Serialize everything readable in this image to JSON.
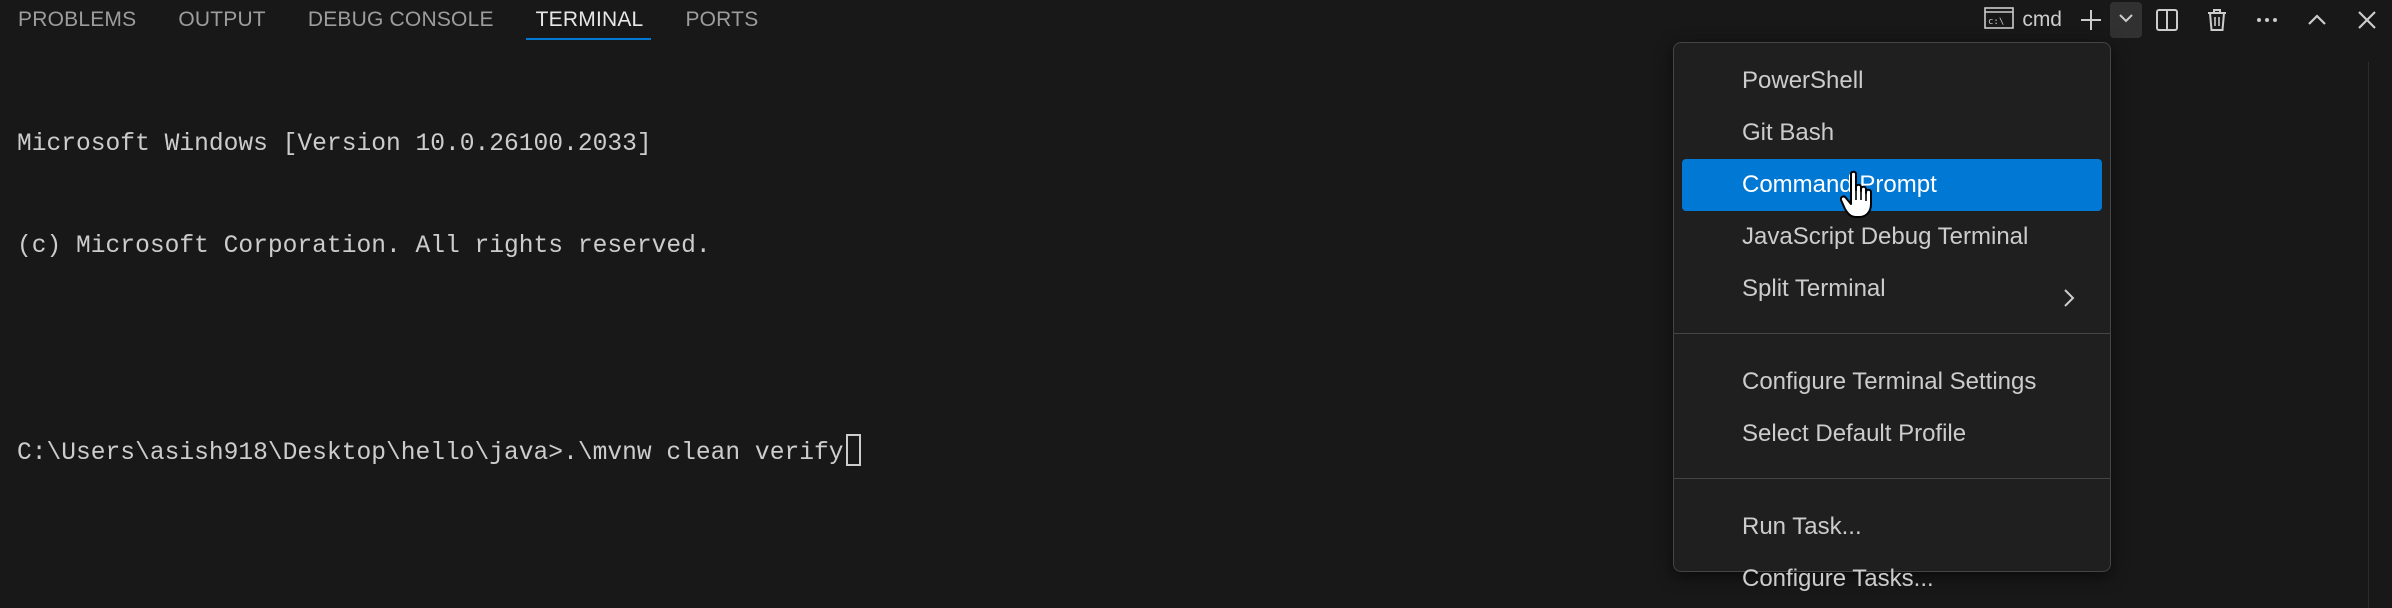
{
  "tabs": [
    {
      "label": "PROBLEMS",
      "active": false
    },
    {
      "label": "OUTPUT",
      "active": false
    },
    {
      "label": "DEBUG CONSOLE",
      "active": false
    },
    {
      "label": "TERMINAL",
      "active": true
    },
    {
      "label": "PORTS",
      "active": false
    }
  ],
  "toolbar": {
    "profile_label": "cmd",
    "profile_icon": "terminal-cmd-icon",
    "buttons": [
      "new-terminal-plus-icon",
      "launch-profile-chevron-icon",
      "split-terminal-icon",
      "kill-terminal-trash-icon",
      "more-actions-ellipsis-icon",
      "maximize-panel-chevron-up-icon",
      "close-panel-icon"
    ]
  },
  "terminal": {
    "lines": [
      "Microsoft Windows [Version 10.0.26100.2033]",
      "(c) Microsoft Corporation. All rights reserved.",
      "",
      "C:\\Users\\asish918\\Desktop\\hello\\java>.\\mvnw clean verify"
    ]
  },
  "menu": {
    "group1": [
      {
        "label": "PowerShell"
      },
      {
        "label": "Git Bash"
      },
      {
        "label": "Command Prompt",
        "selected": true
      },
      {
        "label": "JavaScript Debug Terminal"
      },
      {
        "label": "Split Terminal",
        "submenu": true
      }
    ],
    "group2": [
      {
        "label": "Configure Terminal Settings"
      },
      {
        "label": "Select Default Profile"
      }
    ],
    "group3": [
      {
        "label": "Run Task..."
      },
      {
        "label": "Configure Tasks..."
      }
    ]
  },
  "colors": {
    "background": "#181818",
    "accent": "#0078d4",
    "menu_bg": "#1f1f1f",
    "text": "#cccccc"
  }
}
